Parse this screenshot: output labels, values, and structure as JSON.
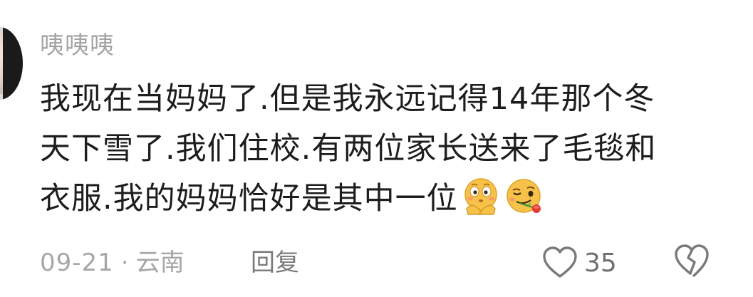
{
  "comment": {
    "username": "咦咦咦",
    "lines": [
      "我现在当妈妈了.但是我永远记得14年那个冬",
      "天下雪了.我们住校.有两位家长送来了毛毯和",
      "衣服.我的妈妈恰好是其中一位"
    ],
    "emojis": [
      "shy-emoji",
      "wink-rose-emoji"
    ],
    "date": "09-21",
    "separator": "·",
    "location": "云南",
    "reply_label": "回复",
    "like_count": "35"
  },
  "icons": {
    "like": "heart-outline-icon",
    "dislike": "broken-heart-outline-icon"
  },
  "colors": {
    "text": "#1d1d1d",
    "secondary": "#a6a6a6",
    "emoji_face": "#f7c24a"
  }
}
